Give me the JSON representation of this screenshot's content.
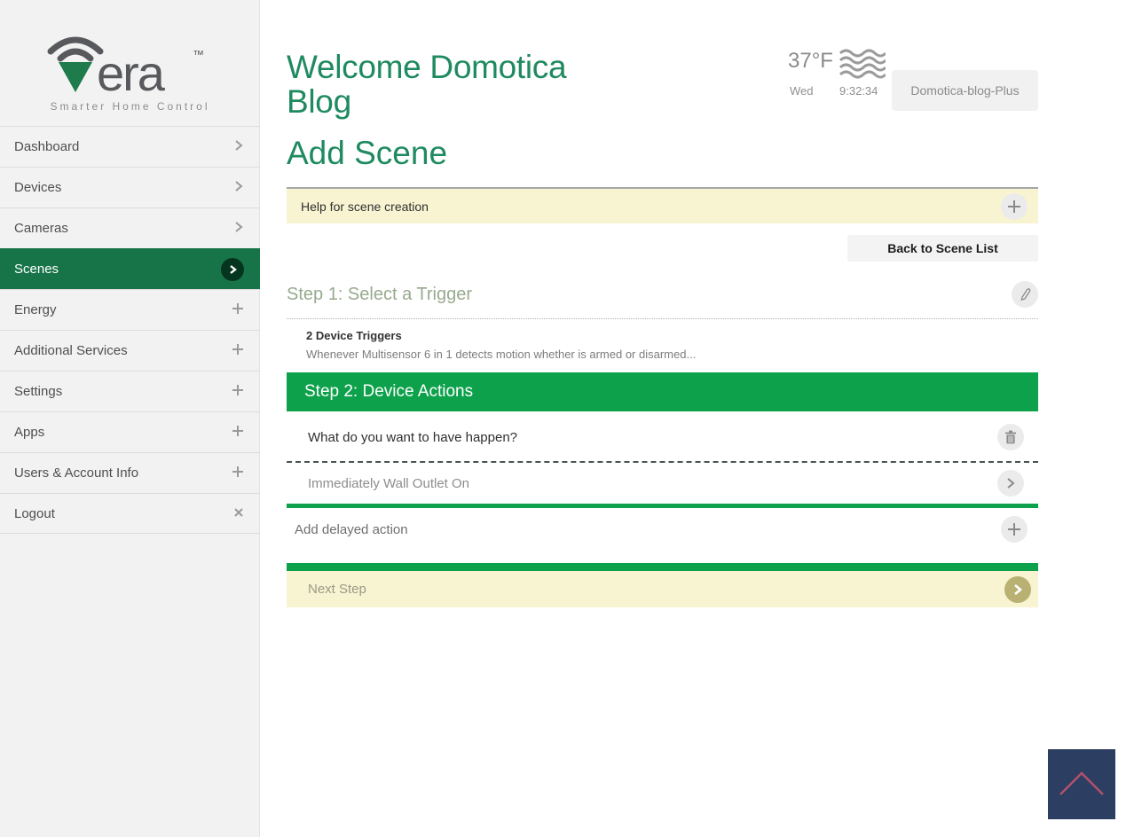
{
  "sidebar": {
    "logo": {
      "brand": "era",
      "tm": "™",
      "tagline": "Smarter Home Control"
    },
    "items": [
      {
        "label": "Dashboard",
        "icon": "chevron-right-icon",
        "active": false
      },
      {
        "label": "Devices",
        "icon": "chevron-right-icon",
        "active": false
      },
      {
        "label": "Cameras",
        "icon": "chevron-right-icon",
        "active": false
      },
      {
        "label": "Scenes",
        "icon": "chevron-circle-icon",
        "active": true
      },
      {
        "label": "Energy",
        "icon": "plus-icon",
        "active": false
      },
      {
        "label": "Additional Services",
        "icon": "plus-icon",
        "active": false
      },
      {
        "label": "Settings",
        "icon": "plus-icon",
        "active": false
      },
      {
        "label": "Apps",
        "icon": "plus-icon",
        "active": false
      },
      {
        "label": "Users & Account Info",
        "icon": "plus-icon",
        "active": false
      },
      {
        "label": "Logout",
        "icon": "close-icon",
        "active": false
      }
    ]
  },
  "header": {
    "welcome": "Welcome Domotica Blog",
    "temperature": "37°F",
    "weather_icon": "fog-icon",
    "day": "Wed",
    "time": "9:32:34",
    "controller": "Domotica-blog-Plus"
  },
  "main": {
    "page_title": "Add Scene",
    "help_bar": {
      "label": "Help for scene creation",
      "icon": "plus-icon"
    },
    "back_button": "Back to Scene List",
    "step1": {
      "title": "Step 1: Select a Trigger",
      "icon": "pencil-icon",
      "trigger_count": "2 Device Triggers",
      "trigger_text": "Whenever Multisensor 6 in 1 detects motion whether is armed or disarmed..."
    },
    "step2": {
      "title": "Step 2: Device Actions",
      "question": "What do you want to have happen?",
      "delete_icon": "trash-icon",
      "action": "Immediately Wall Outlet On",
      "action_icon": "chevron-right-icon",
      "add_delayed": "Add delayed action",
      "add_icon": "plus-icon"
    },
    "next_step": {
      "label": "Next Step",
      "icon": "chevron-right-icon"
    }
  },
  "colors": {
    "accent_green": "#0da14b",
    "sidebar_active_green": "#177449",
    "title_green": "#1f8a60",
    "help_yellow": "#f8f4d2",
    "scroll_top_navy": "#2d3e63",
    "scroll_top_chevron": "#b2506b"
  }
}
